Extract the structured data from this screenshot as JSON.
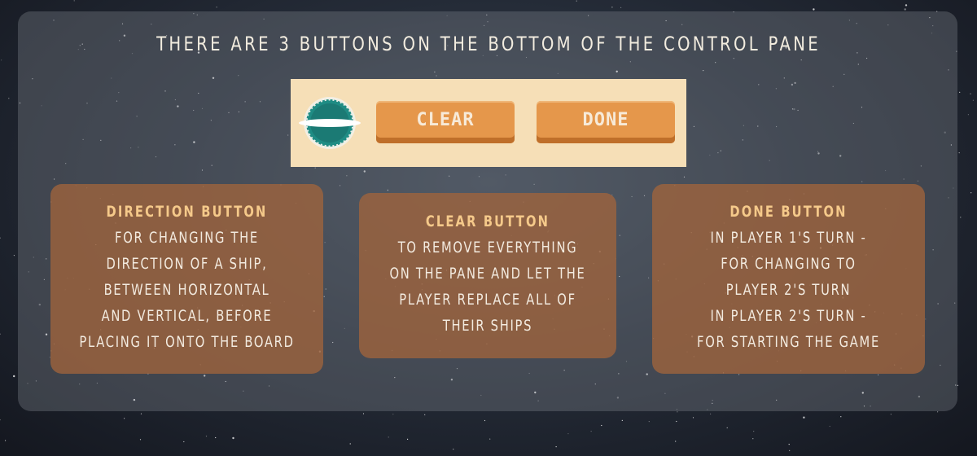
{
  "title": "There are 3 buttons on the bottom of the control pane",
  "control_pane": {
    "direction_icon": "ship-direction-icon",
    "clear_label": "CLEAR",
    "done_label": "DONE"
  },
  "cards": {
    "direction": {
      "title": "Direction Button",
      "lines": [
        "For changing the",
        "direction of a ship,",
        "between horizontal",
        "and vertical, before",
        "placing it onto the board"
      ]
    },
    "clear": {
      "title": "Clear Button",
      "lines": [
        "to remove everything",
        "on the pane and let the",
        "player replace all of",
        "their ships"
      ]
    },
    "done": {
      "title": "Done Button",
      "lines": [
        "In player 1's turn -",
        "for changing to",
        "player 2's turn",
        "In player 2's turn -",
        "for starting the game"
      ]
    }
  },
  "colors": {
    "panel": "#787d87",
    "control_pane": "#f6dfb7",
    "button": "#e5974b",
    "card": "#a0643c",
    "card_title": "#f5c98a",
    "direction_icon": "#1f8c84"
  }
}
